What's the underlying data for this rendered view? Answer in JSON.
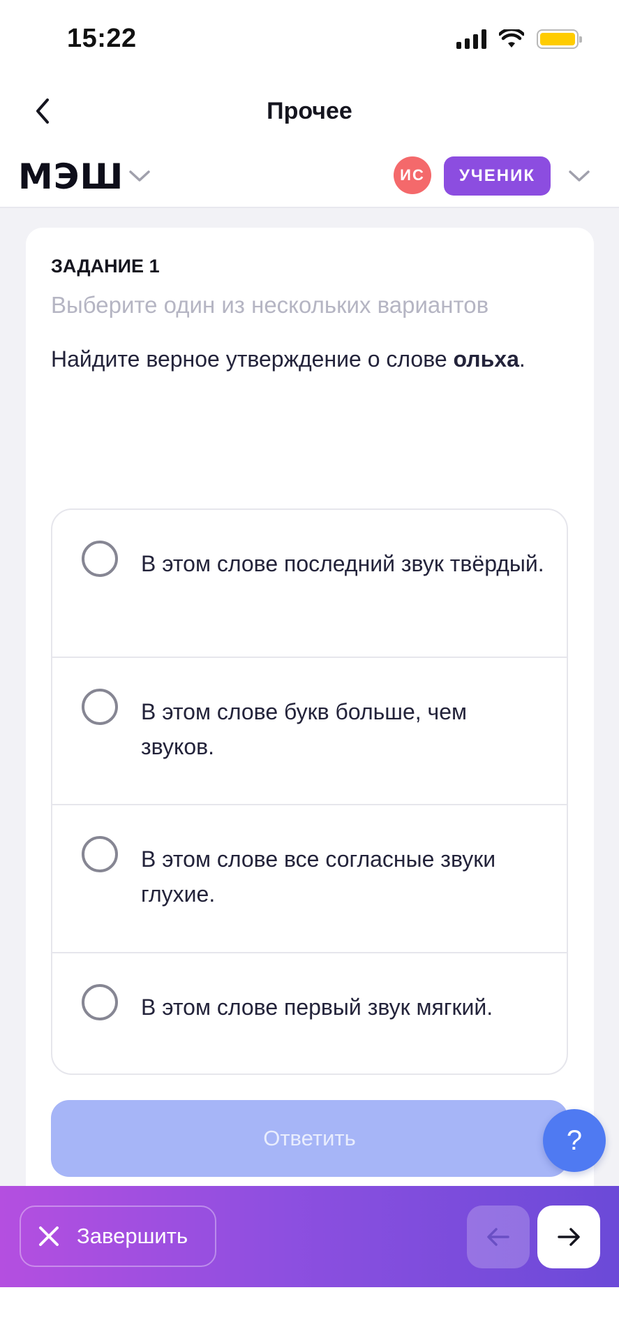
{
  "status_bar": {
    "time": "15:22"
  },
  "header": {
    "title": "Прочее"
  },
  "brand": {
    "logo": "МЭШ",
    "avatar_initials": "ИС",
    "role": "УЧЕНИК"
  },
  "task": {
    "label": "ЗАДАНИЕ 1",
    "instruction": "Выберите один из нескольких вариантов",
    "question_prefix": "Найдите верное утверждение о слове ",
    "question_word": "ольха",
    "question_suffix": ".",
    "options": [
      "В этом слове последний звук твёрдый.",
      "В этом слове букв больше, чем звуков.",
      "В этом слове все согласные звуки глухие.",
      "В этом слове первый звук мягкий."
    ],
    "answer_label": "Ответить",
    "help_label": "?"
  },
  "bottom_bar": {
    "finish_label": "Завершить"
  },
  "colors": {
    "accent_purple": "#8c4de0",
    "avatar_red": "#f4696b",
    "answer_disabled": "#a6b5f7",
    "help_blue": "#4f7af2",
    "battery_yellow": "#ffcc00"
  },
  "icons": [
    "back-icon",
    "chevron-down-icon",
    "close-icon",
    "arrow-left-icon",
    "arrow-right-icon",
    "signal-icon",
    "wifi-icon",
    "battery-icon"
  ]
}
